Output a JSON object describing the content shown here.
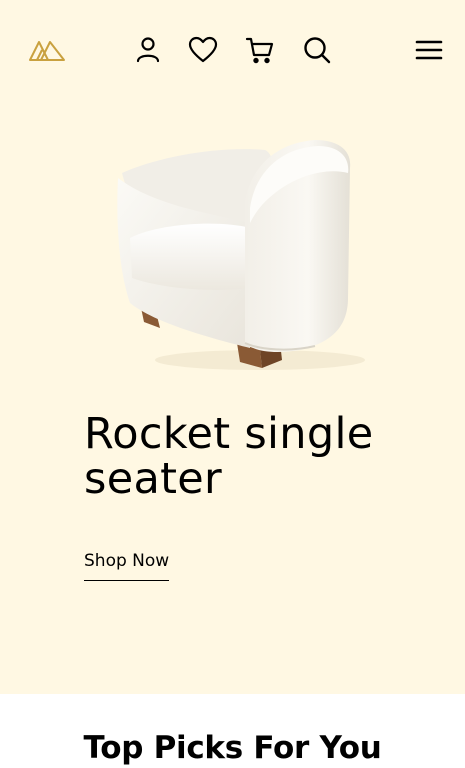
{
  "header": {
    "logo_icon": "brand-logo-icon",
    "icons": [
      "user-icon",
      "heart-icon",
      "cart-icon",
      "search-icon",
      "menu-icon"
    ]
  },
  "hero": {
    "title": "Rocket single seater",
    "cta_label": "Shop Now",
    "background": "#fff8e3"
  },
  "section": {
    "title": "Top Picks For You"
  },
  "colors": {
    "logo": "#c9a13f",
    "text": "#000000"
  }
}
